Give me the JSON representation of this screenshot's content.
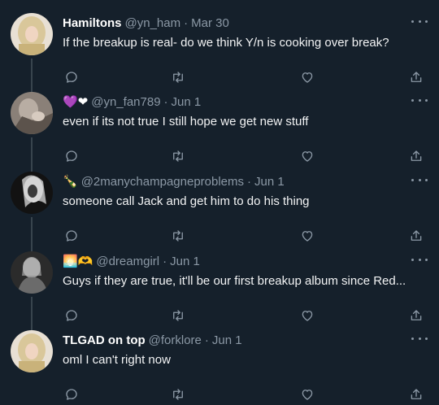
{
  "tweets": [
    {
      "display_name": "Hamiltons",
      "emoji": "",
      "handle": "@yn_ham",
      "separator": "·",
      "date": "Mar 30",
      "text": "If the breakup is real- do we think Y/n is cooking over break?"
    },
    {
      "display_name": "",
      "emoji": "💜❤",
      "handle": "@yn_fan789",
      "separator": "·",
      "date": "Jun 1",
      "text": "even if its not true I still hope we get new stuff"
    },
    {
      "display_name": "",
      "emoji": "🍾",
      "handle": "@2manychampagneproblems",
      "separator": "·",
      "date": "Jun 1",
      "text": "someone call Jack and get him to do his thing"
    },
    {
      "display_name": "",
      "emoji": "🌅🫶",
      "handle": "@dreamgirl",
      "separator": "·",
      "date": "Jun 1",
      "text": "Guys if they are true, it'll be our first breakup album since Red..."
    },
    {
      "display_name": "TLGAD on top",
      "emoji": "",
      "handle": "@forklore",
      "separator": "·",
      "date": "Jun 1",
      "text": "oml I can't right now"
    }
  ],
  "icons": {
    "reply": "reply-icon",
    "retweet": "retweet-icon",
    "like": "like-icon",
    "share": "share-icon",
    "more": "more-icon"
  },
  "colors": {
    "background": "#15202b",
    "secondary_text": "#8b98a5",
    "thread_line": "#38444d"
  }
}
